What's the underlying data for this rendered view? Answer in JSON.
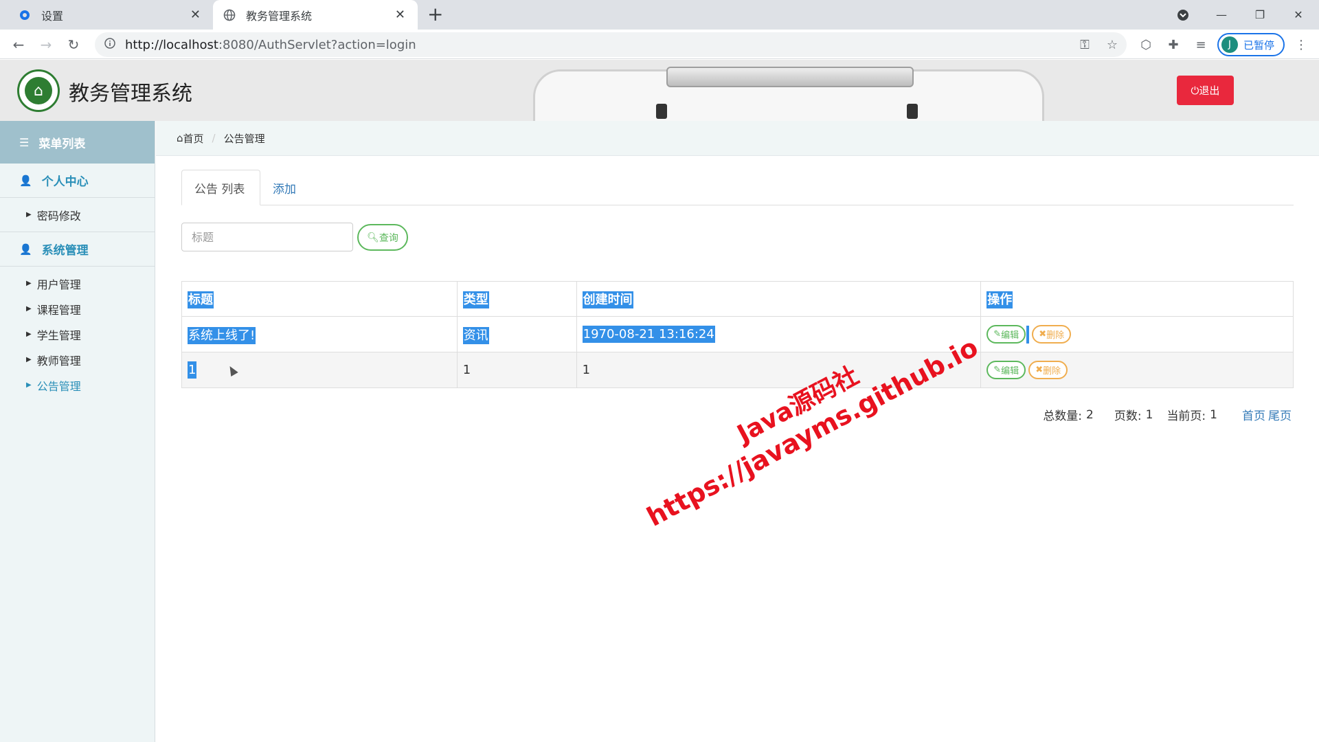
{
  "browser": {
    "tabs": [
      {
        "label": "设置",
        "icon": "gear-icon"
      },
      {
        "label": "教务管理系统",
        "icon": "globe-icon"
      }
    ],
    "url_host": "http://localhost",
    "url_rest": ":8080/AuthServlet?action=login",
    "profile_initial": "J",
    "profile_label": "已暂停"
  },
  "header": {
    "title": "教务管理系统",
    "logout_label": "退出",
    "logout_color": "#e9283d"
  },
  "sidebar": {
    "title": "菜单列表",
    "groups": [
      {
        "label": "个人中心",
        "items": [
          {
            "label": "密码修改"
          }
        ]
      },
      {
        "label": "系统管理",
        "items": [
          {
            "label": "用户管理"
          },
          {
            "label": "课程管理"
          },
          {
            "label": "学生管理"
          },
          {
            "label": "教师管理"
          },
          {
            "label": "公告管理"
          }
        ]
      }
    ]
  },
  "breadcrumb": {
    "home": "首页",
    "current": "公告管理"
  },
  "content_tabs": {
    "list": "公告 列表",
    "add": "添加"
  },
  "search": {
    "placeholder": "标题",
    "button": "查询"
  },
  "table": {
    "headers": [
      "标题",
      "类型",
      "创建时间",
      "操作"
    ],
    "rows": [
      {
        "title": "系统上线了!",
        "type": "资讯",
        "created": "1970-08-21 13:16:24"
      },
      {
        "title": "1",
        "type": "1",
        "created": "1"
      }
    ],
    "edit_label": "编辑",
    "delete_label": "删除"
  },
  "pager": {
    "total_label": "总数量:",
    "total": "2",
    "pages_label": "页数:",
    "pages": "1",
    "current_label": "当前页:",
    "current": "1",
    "first": "首页",
    "last": "尾页"
  },
  "watermark": {
    "line1": "Java源码社",
    "line2": "https://javayms.github.io"
  },
  "colors": {
    "accent": "#2a8fb8",
    "success": "#5cb85c",
    "warning": "#f0ad4e",
    "selection": "#3390e8"
  }
}
